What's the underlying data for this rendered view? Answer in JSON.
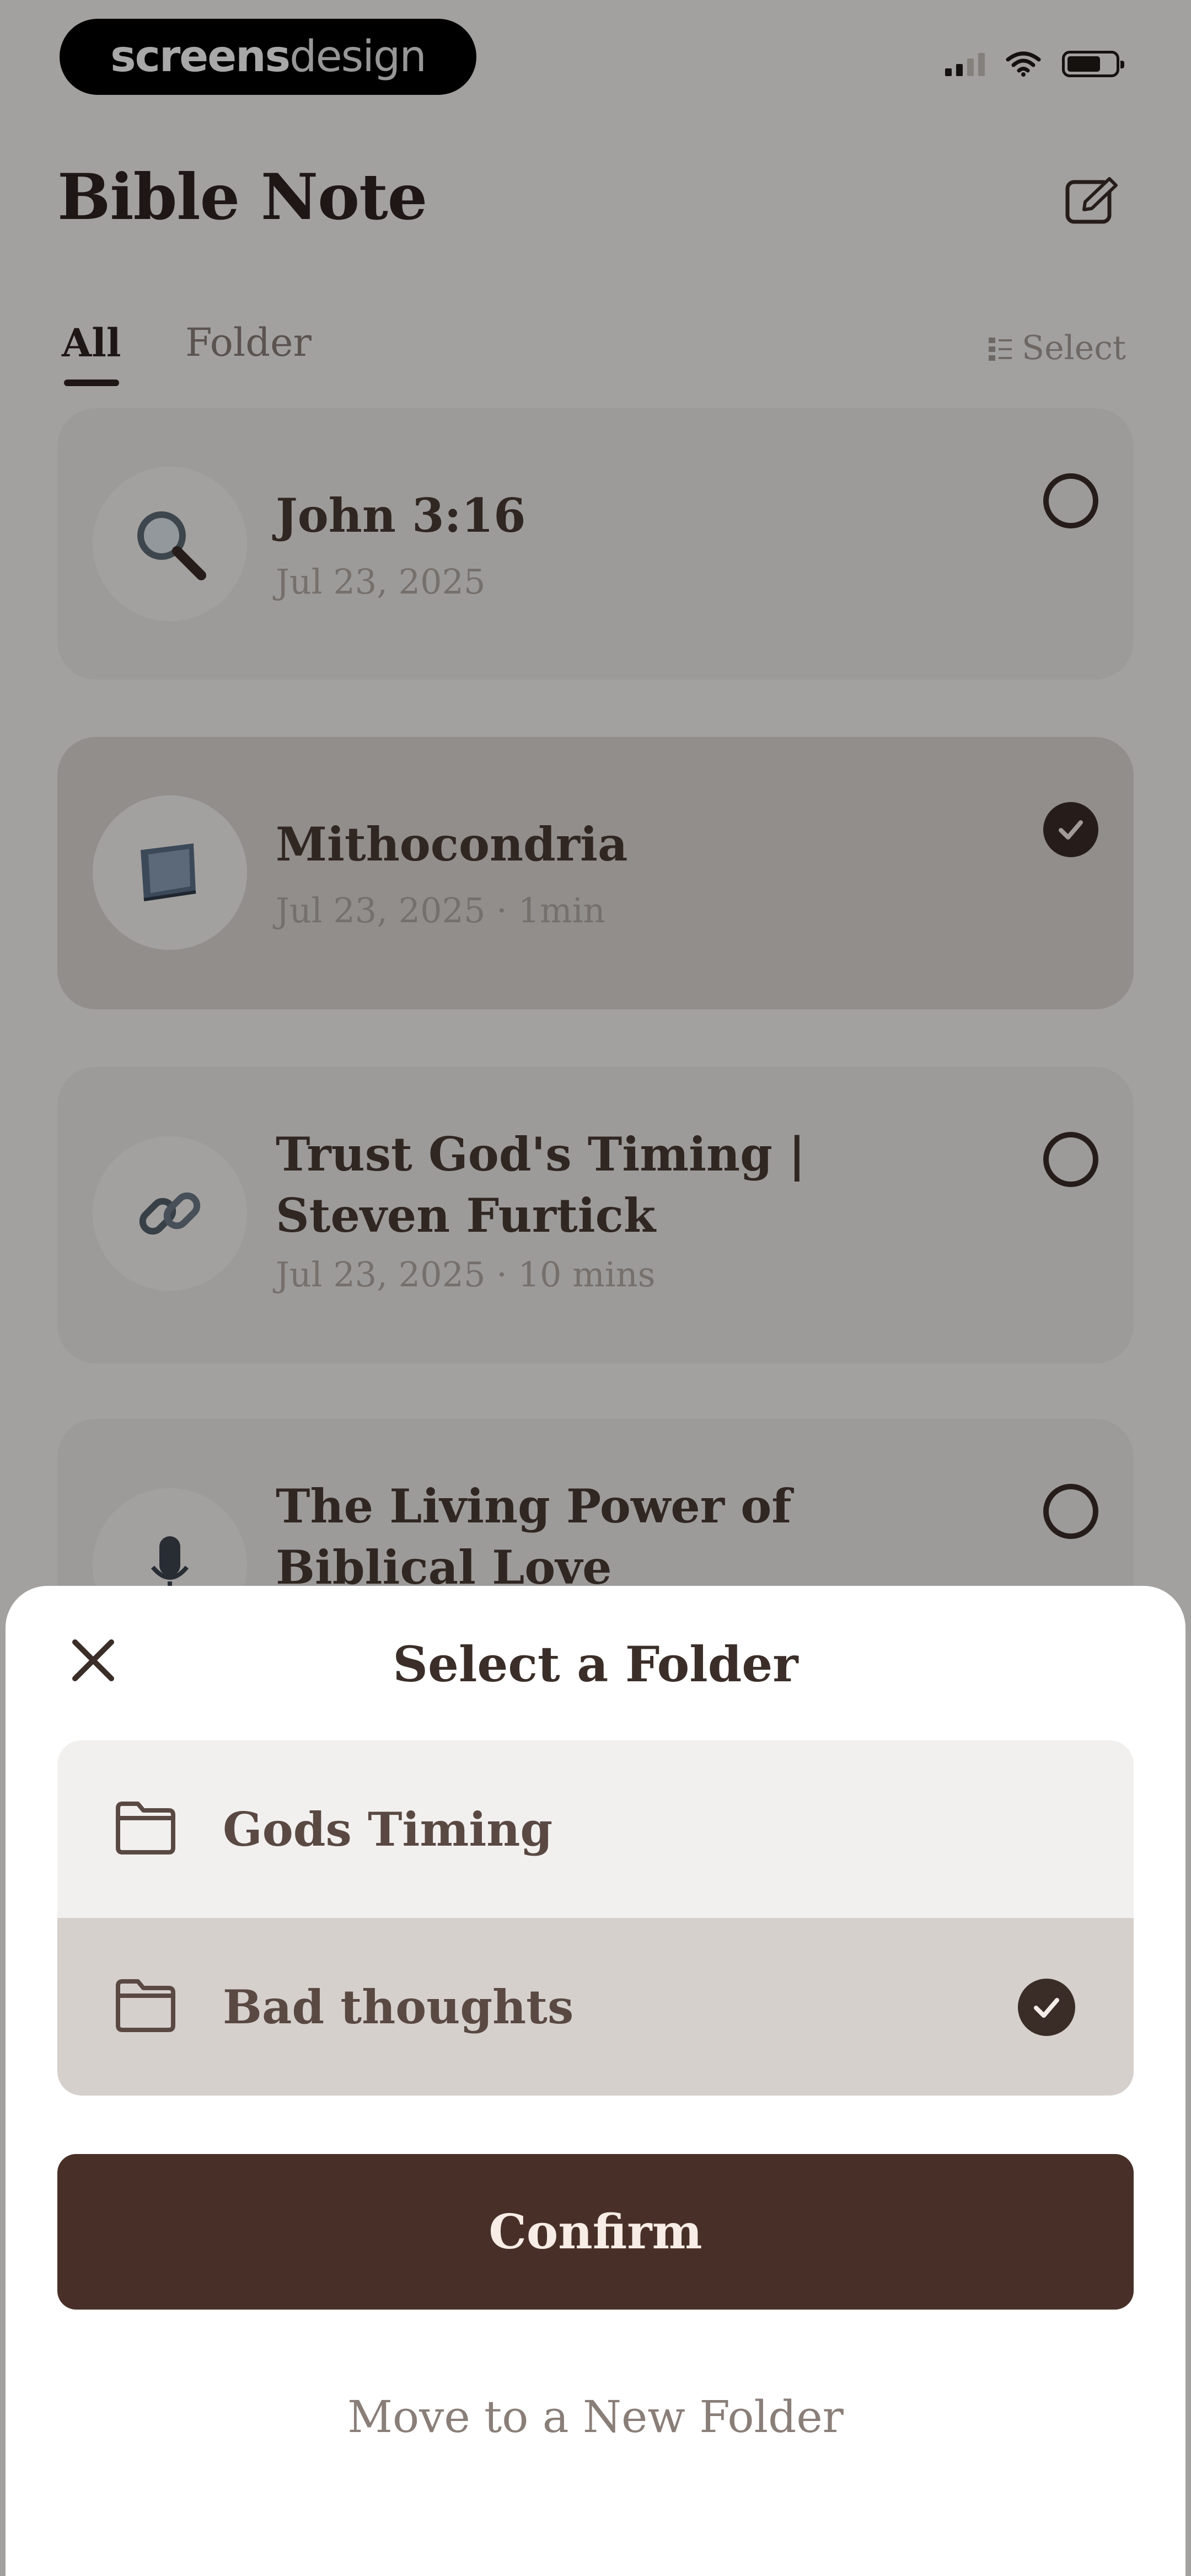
{
  "status_bar": {
    "brand_bold": "screens",
    "brand_light": "design",
    "icons": [
      "cellular-signal-icon",
      "wifi-icon",
      "battery-icon"
    ]
  },
  "header": {
    "title": "Bible Note",
    "new_note_icon": "new-note-icon"
  },
  "tabs": [
    {
      "label": "All",
      "active": true
    },
    {
      "label": "Folder",
      "active": false
    }
  ],
  "select_label": "Select",
  "notes": [
    {
      "title": "John 3:16",
      "meta": "Jul 23, 2025",
      "icon": "magnifier-icon",
      "selected": false
    },
    {
      "title": "Mithocondria",
      "meta": "Jul 23, 2025 · 1min",
      "icon": "book-icon",
      "selected": true
    },
    {
      "title": "Trust God's Timing | Steven Furtick",
      "meta": "Jul 23, 2025 · 10 mins",
      "icon": "link-icon",
      "selected": false
    },
    {
      "title": "The Living Power of Biblical Love",
      "meta": "",
      "icon": "microphone-icon",
      "selected": false
    }
  ],
  "sheet": {
    "title": "Select a Folder",
    "folders": [
      {
        "name": "Gods Timing",
        "selected": false
      },
      {
        "name": "Bad thoughts",
        "selected": true
      }
    ],
    "confirm_label": "Confirm",
    "new_folder_label": "Move to a New Folder"
  },
  "colors": {
    "background": "#f7f4f1",
    "card": "#efebe8",
    "card_selected": "#ded8d3",
    "accent_brown": "#483028",
    "overlay": "rgba(0,0,0,0.34)"
  }
}
